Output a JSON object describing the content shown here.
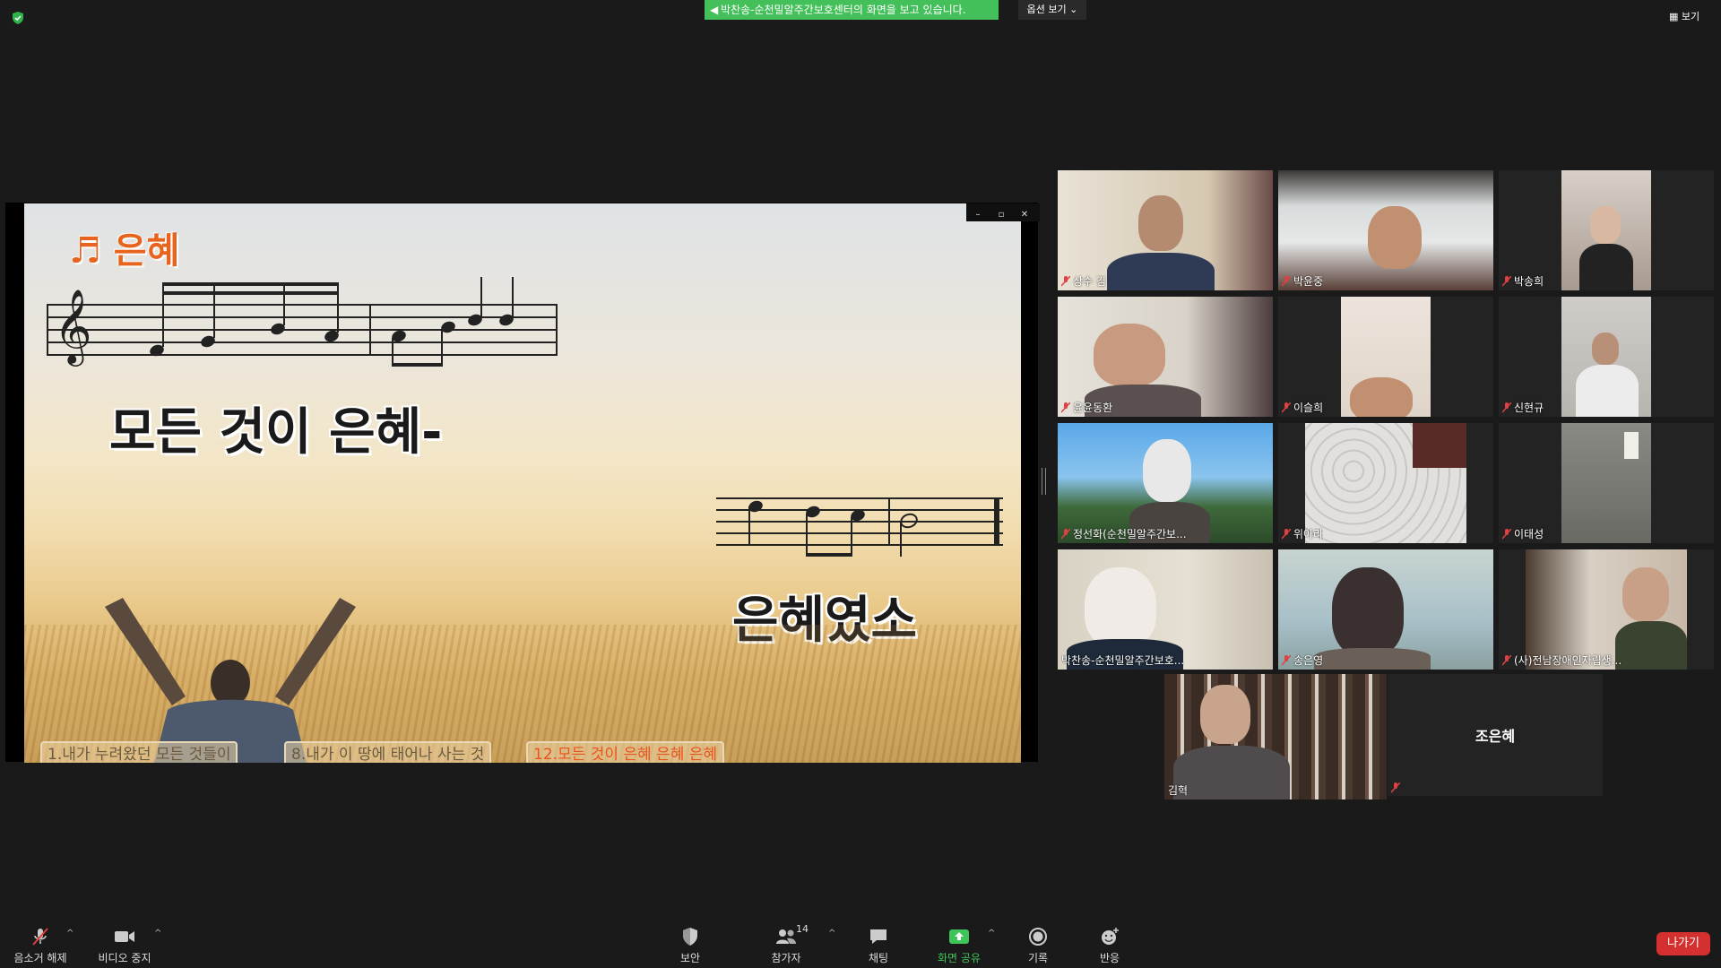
{
  "top": {
    "share_banner": "박찬송-순천밀알주간보호센터의 화면을 보고 있습니다.",
    "view_options": "옵션 보기",
    "view_button": "보기"
  },
  "slide": {
    "title": "은혜",
    "lyric_line1": "모든 것이 은혜-",
    "lyric_line2": "은혜였소",
    "chips": [
      "1.내가 누려왔던 모든 것들이",
      "8.내가 이 땅에 태어나 사는 것",
      "12.모든 것이 은혜 은혜 은혜"
    ],
    "window_controls": [
      "–",
      "▫",
      "✕"
    ]
  },
  "participants": [
    {
      "name": "상수 김"
    },
    {
      "name": "박윤중"
    },
    {
      "name": "박송희"
    },
    {
      "name": "윤윤동환"
    },
    {
      "name": "이슬희"
    },
    {
      "name": "신현규"
    },
    {
      "name": "정선화(순천밀알주간보..."
    },
    {
      "name": "위아라"
    },
    {
      "name": "이태성"
    },
    {
      "name": "박찬송-순천밀알주간보호..."
    },
    {
      "name": "송은영"
    },
    {
      "name": "(사)전남장애인자립생..."
    },
    {
      "name": "김혁"
    },
    {
      "name": "조은혜"
    }
  ],
  "toolbar": {
    "unmute": "음소거 해제",
    "stop_video": "비디오 중지",
    "security": "보안",
    "participants": "참가자",
    "participants_count": "14",
    "chat": "채팅",
    "share_screen": "화면 공유",
    "record": "기록",
    "reactions": "반응",
    "leave": "나가기"
  },
  "colors": {
    "share_green": "#44c05a",
    "leave_red": "#d3302f",
    "active_speaker": "#e6df6a"
  }
}
